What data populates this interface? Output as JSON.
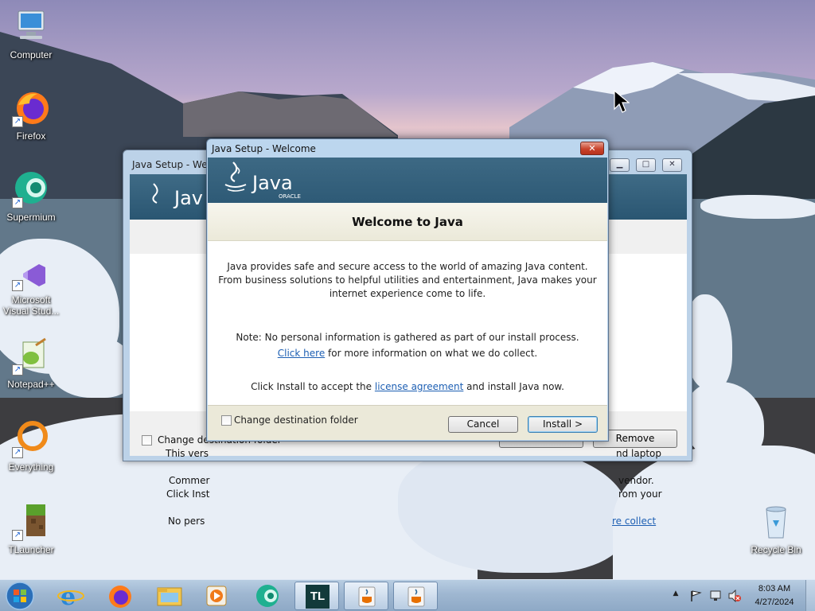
{
  "desktop": {
    "icons": [
      {
        "label": "Computer"
      },
      {
        "label": "Firefox"
      },
      {
        "label": "Supermium"
      },
      {
        "label": "Microsoft Visual Stud..."
      },
      {
        "label": "Notepad++"
      },
      {
        "label": "Everything"
      },
      {
        "label": "TLauncher"
      },
      {
        "label": "Recycle Bin"
      }
    ]
  },
  "background_window": {
    "title": "Java Setup - Welc",
    "line1_left": "This vers",
    "line1_right": "nd laptop",
    "line2_left": "Commer",
    "line2_right": "vendor.",
    "line3_left": "Click Inst",
    "line3_right": "rom your",
    "line4_left": "No pers",
    "line4_right": "re collect",
    "checkbox_label": "Change destination folder",
    "remove_label": "Remove"
  },
  "dialog": {
    "title": "Java Setup - Welcome",
    "close_glyph": "✕",
    "logo_word": "Java",
    "logo_sub": "ORACLE",
    "heading": "Welcome to Java",
    "intro_line1": "Java provides safe and secure access to the world of amazing Java content.",
    "intro_line2": "From business solutions to helpful utilities and entertainment, Java makes your",
    "intro_line3": "internet experience come to life.",
    "note_line": "Note: No personal information is gathered as part of our install process.",
    "click_here": "Click here",
    "click_here_rest": " for more information on what we do collect.",
    "install_prefix": "Click Install to accept the ",
    "license_link": "license agreement",
    "install_suffix": " and install Java now.",
    "checkbox_label": "Change destination folder",
    "cancel_label": "Cancel",
    "install_label": "Install >"
  },
  "taskbar": {
    "tl_label": "TL",
    "time": "8:03 AM",
    "date": "4/27/2024"
  },
  "colors": {
    "java_banner": "#2e5a76",
    "java_red": "#e76f00",
    "link": "#1d5fb3"
  }
}
